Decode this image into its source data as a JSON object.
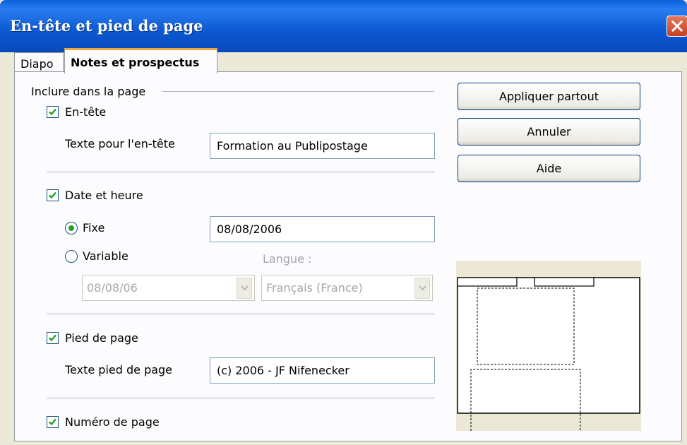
{
  "window": {
    "title": "En-tête et pied de page"
  },
  "tabs": [
    {
      "label": "Diapo",
      "active": false
    },
    {
      "label": "Notes et prospectus",
      "active": true
    }
  ],
  "group": {
    "label": "Inclure dans la page"
  },
  "header": {
    "checkbox_label": "En-tête",
    "checked": true,
    "text_label": "Texte pour l'en-tête",
    "text_value": "Formation au Publipostage"
  },
  "datetime": {
    "checkbox_label": "Date et heure",
    "checked": true,
    "fixed_label": "Fixe",
    "fixed_selected": true,
    "fixed_value": "08/08/2006",
    "variable_label": "Variable",
    "variable_selected": false,
    "format_value": "08/08/06",
    "language_label": "Langue :",
    "language_value": "Français (France)"
  },
  "footer": {
    "checkbox_label": "Pied de page",
    "checked": true,
    "text_label": "Texte pied de page",
    "text_value": "(c) 2006 - JF Nifenecker"
  },
  "page_number": {
    "checkbox_label": "Numéro de page",
    "checked": true
  },
  "buttons": {
    "apply_all": "Appliquer partout",
    "cancel": "Annuler",
    "help": "Aide"
  },
  "colors": {
    "titlebar": "#0b58d2",
    "tab_highlight": "#f1a53b",
    "check_mark": "#21a121",
    "close_button": "#c6401d"
  }
}
